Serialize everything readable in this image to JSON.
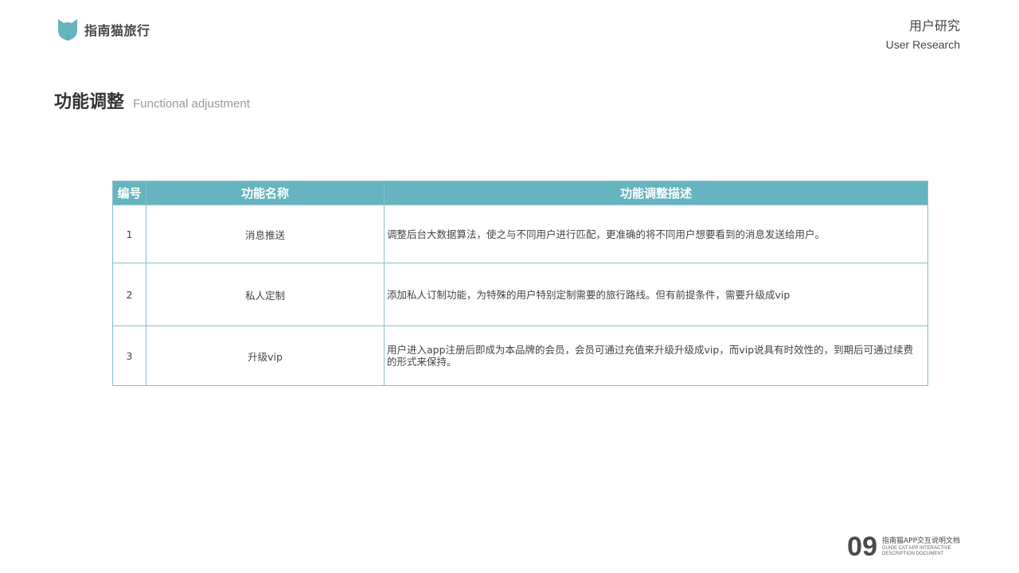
{
  "brand": {
    "name": "指南猫旅行",
    "color": "#66b4bf"
  },
  "section": {
    "title_cn": "用户研究",
    "title_en": "User Research"
  },
  "heading": {
    "title": "功能调整",
    "subtitle": "Functional adjustment"
  },
  "table": {
    "header_color": "#66b4bf",
    "columns": [
      "编号",
      "功能名称",
      "功能调整描述"
    ],
    "rows": [
      {
        "no": "1",
        "name": "消息推送",
        "desc": "调整后台大数据算法，使之与不同用户进行匹配，更准确的将不同用户想要看到的消息发送给用户。"
      },
      {
        "no": "2",
        "name": "私人定制",
        "desc": "添加私人订制功能，为特殊的用户特别定制需要的旅行路线。但有前提条件，需要升级成vip"
      },
      {
        "no": "3",
        "name": "升级vip",
        "desc": "用户进入app注册后即成为本品牌的会员，会员可通过充值来升级升级成vip，而vip说具有时效性的，到期后可通过续费的形式来保持。"
      }
    ]
  },
  "footer": {
    "page_number": "09",
    "doc_title_cn": "指南猫APP交互说明文档",
    "doc_title_en_line1": "GUIDE CAT APP INTERACTIVE",
    "doc_title_en_line2": "DESCRIPTION DOCUMENT"
  }
}
